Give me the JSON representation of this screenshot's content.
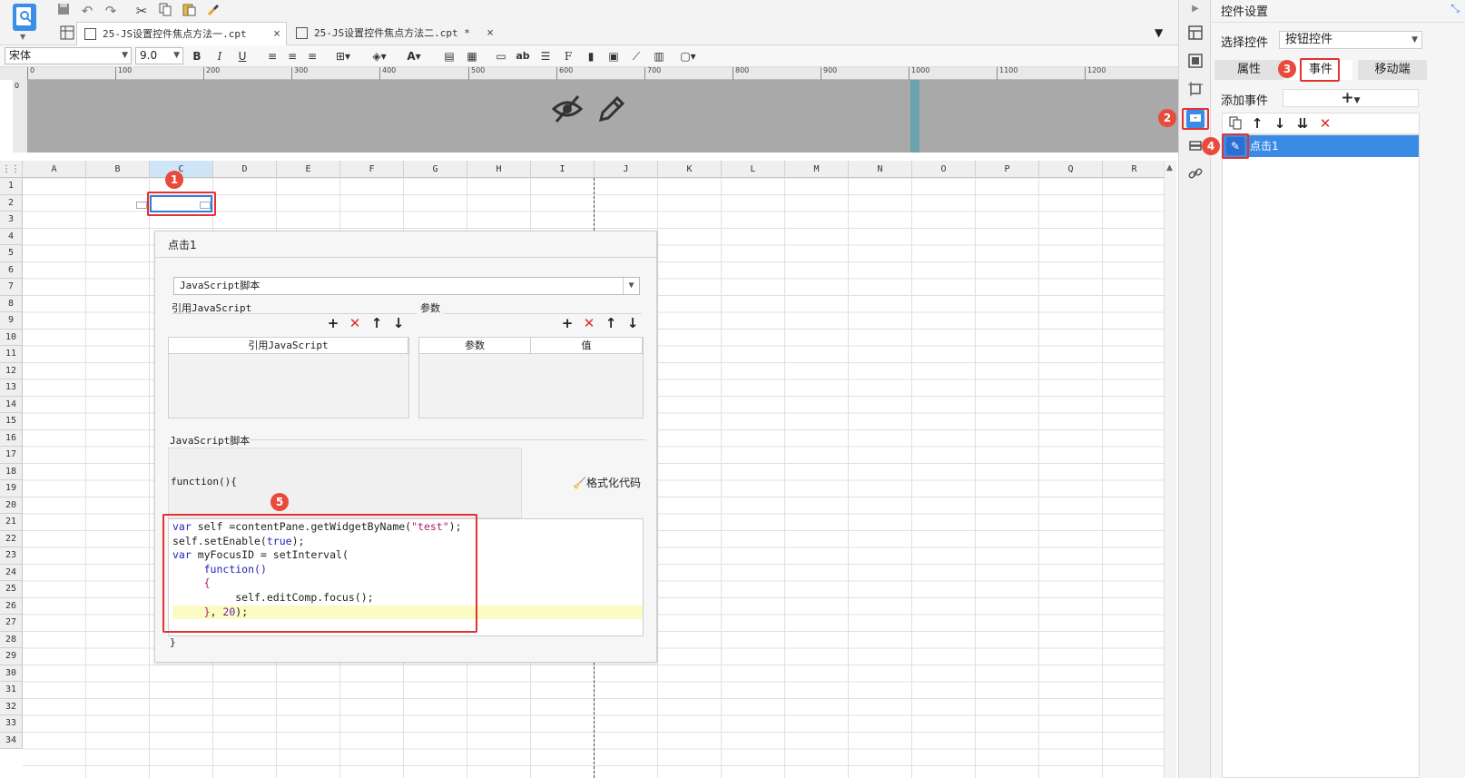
{
  "tabs": [
    {
      "label": "25-JS设置控件焦点方法一.cpt",
      "close": "×"
    },
    {
      "label": "25-JS设置控件焦点方法二.cpt *",
      "close": "×"
    }
  ],
  "format": {
    "font_name": "宋体",
    "font_size": "9.0"
  },
  "ruler": {
    "ticks": [
      "0",
      "100",
      "200",
      "300",
      "400",
      "500",
      "600",
      "700",
      "800",
      "900",
      "1000",
      "1100",
      "1200"
    ],
    "vtick": "0"
  },
  "grid": {
    "columns": [
      "A",
      "B",
      "C",
      "D",
      "E",
      "F",
      "G",
      "H",
      "I",
      "J",
      "K",
      "L",
      "M",
      "N",
      "O",
      "P",
      "Q",
      "R"
    ],
    "selected_column": "C",
    "rows": [
      "1",
      "2",
      "3",
      "4",
      "5",
      "6",
      "7",
      "8",
      "9",
      "10",
      "11",
      "12",
      "13",
      "14",
      "15",
      "16",
      "17",
      "18",
      "19",
      "20",
      "21",
      "22",
      "23",
      "24",
      "25",
      "26",
      "27",
      "28",
      "29",
      "30",
      "31",
      "32",
      "33",
      "34"
    ]
  },
  "callouts": [
    "1",
    "2",
    "3",
    "4",
    "5"
  ],
  "dialog": {
    "title": "点击1",
    "type_value": "JavaScript脚本",
    "ref_js_label": "引用JavaScript",
    "params_label": "参数",
    "ref_js_header": "引用JavaScript",
    "param_header": "参数",
    "value_header": "值",
    "script_label": "JavaScript脚本",
    "func_open": "function(){",
    "format_code": "格式化代码",
    "func_close": "}",
    "code_lines": [
      {
        "tokens": [
          {
            "t": "var",
            "c": "kw"
          },
          {
            "t": " self =contentPane.getWidgetByName("
          },
          {
            "t": "\"test\"",
            "c": "str"
          },
          {
            "t": ");"
          }
        ]
      },
      {
        "tokens": [
          {
            "t": "self.setEnable("
          },
          {
            "t": "true",
            "c": "kw"
          },
          {
            "t": ");"
          }
        ]
      },
      {
        "tokens": [
          {
            "t": "var",
            "c": "kw"
          },
          {
            "t": " myFocusID = setInterval("
          }
        ]
      },
      {
        "tokens": [
          {
            "t": "     "
          },
          {
            "t": "function",
            "c": "kw"
          },
          {
            "t": "()",
            "c": "kw"
          }
        ]
      },
      {
        "tokens": [
          {
            "t": "     "
          },
          {
            "t": "{",
            "c": "str"
          }
        ]
      },
      {
        "tokens": [
          {
            "t": "          self.editComp.focus();"
          }
        ]
      },
      {
        "tokens": [
          {
            "t": "     "
          },
          {
            "t": "}",
            "c": "str"
          },
          {
            "t": ", "
          },
          {
            "t": "20",
            "c": "num"
          },
          {
            "t": ");"
          }
        ],
        "highlight": true
      },
      {
        "tokens": [
          {
            "t": ""
          }
        ]
      }
    ]
  },
  "panel": {
    "title": "控件设置",
    "select_label": "选择控件",
    "select_value": "按钮控件",
    "tabs": [
      "属性",
      "事件",
      "移动端"
    ],
    "add_event_label": "添加事件",
    "add_event_btn": "+",
    "event_item": "点击1"
  }
}
